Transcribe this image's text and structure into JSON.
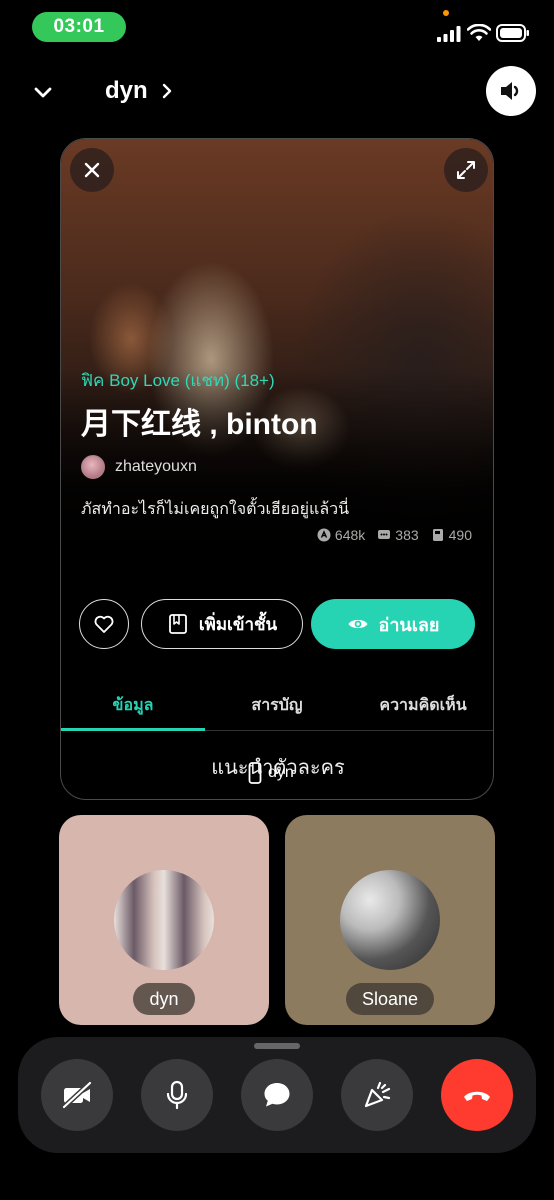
{
  "status_bar": {
    "time": "03:01"
  },
  "header": {
    "title": "dyn"
  },
  "story": {
    "genre": "ฟิค Boy Love (แชท) (18+)",
    "title": "月下红线 , binton",
    "author": "zhateyouxn",
    "description": "ภัสทำอะไรก็ไม่เคยถูกใจตั้วเฮียอยู่แล้วนี่",
    "stats": {
      "reads": "648k",
      "comments": "383",
      "chapters": "490"
    },
    "actions": {
      "library_label": "เพิ่มเข้าชั้น",
      "read_label": "อ่านเลย"
    },
    "tabs": [
      "ข้อมูล",
      "สารบัญ",
      "ความคิดเห็น"
    ],
    "section_title": "แนะนำตัวละคร"
  },
  "share_tag": "dyn",
  "participants": [
    {
      "name": "dyn"
    },
    {
      "name": "Sloane"
    }
  ],
  "colors": {
    "accent": "#26d3b3",
    "end_call": "#ff3b30",
    "status_pill": "#34c759"
  },
  "icons": [
    "chevron-down-icon",
    "chevron-right-icon",
    "speaker-icon",
    "close-icon",
    "expand-icon",
    "heart-icon",
    "book-icon",
    "eye-icon",
    "phone-icon",
    "camera-off-icon",
    "mic-icon",
    "chat-bubble-icon",
    "effects-icon",
    "end-call-icon"
  ]
}
